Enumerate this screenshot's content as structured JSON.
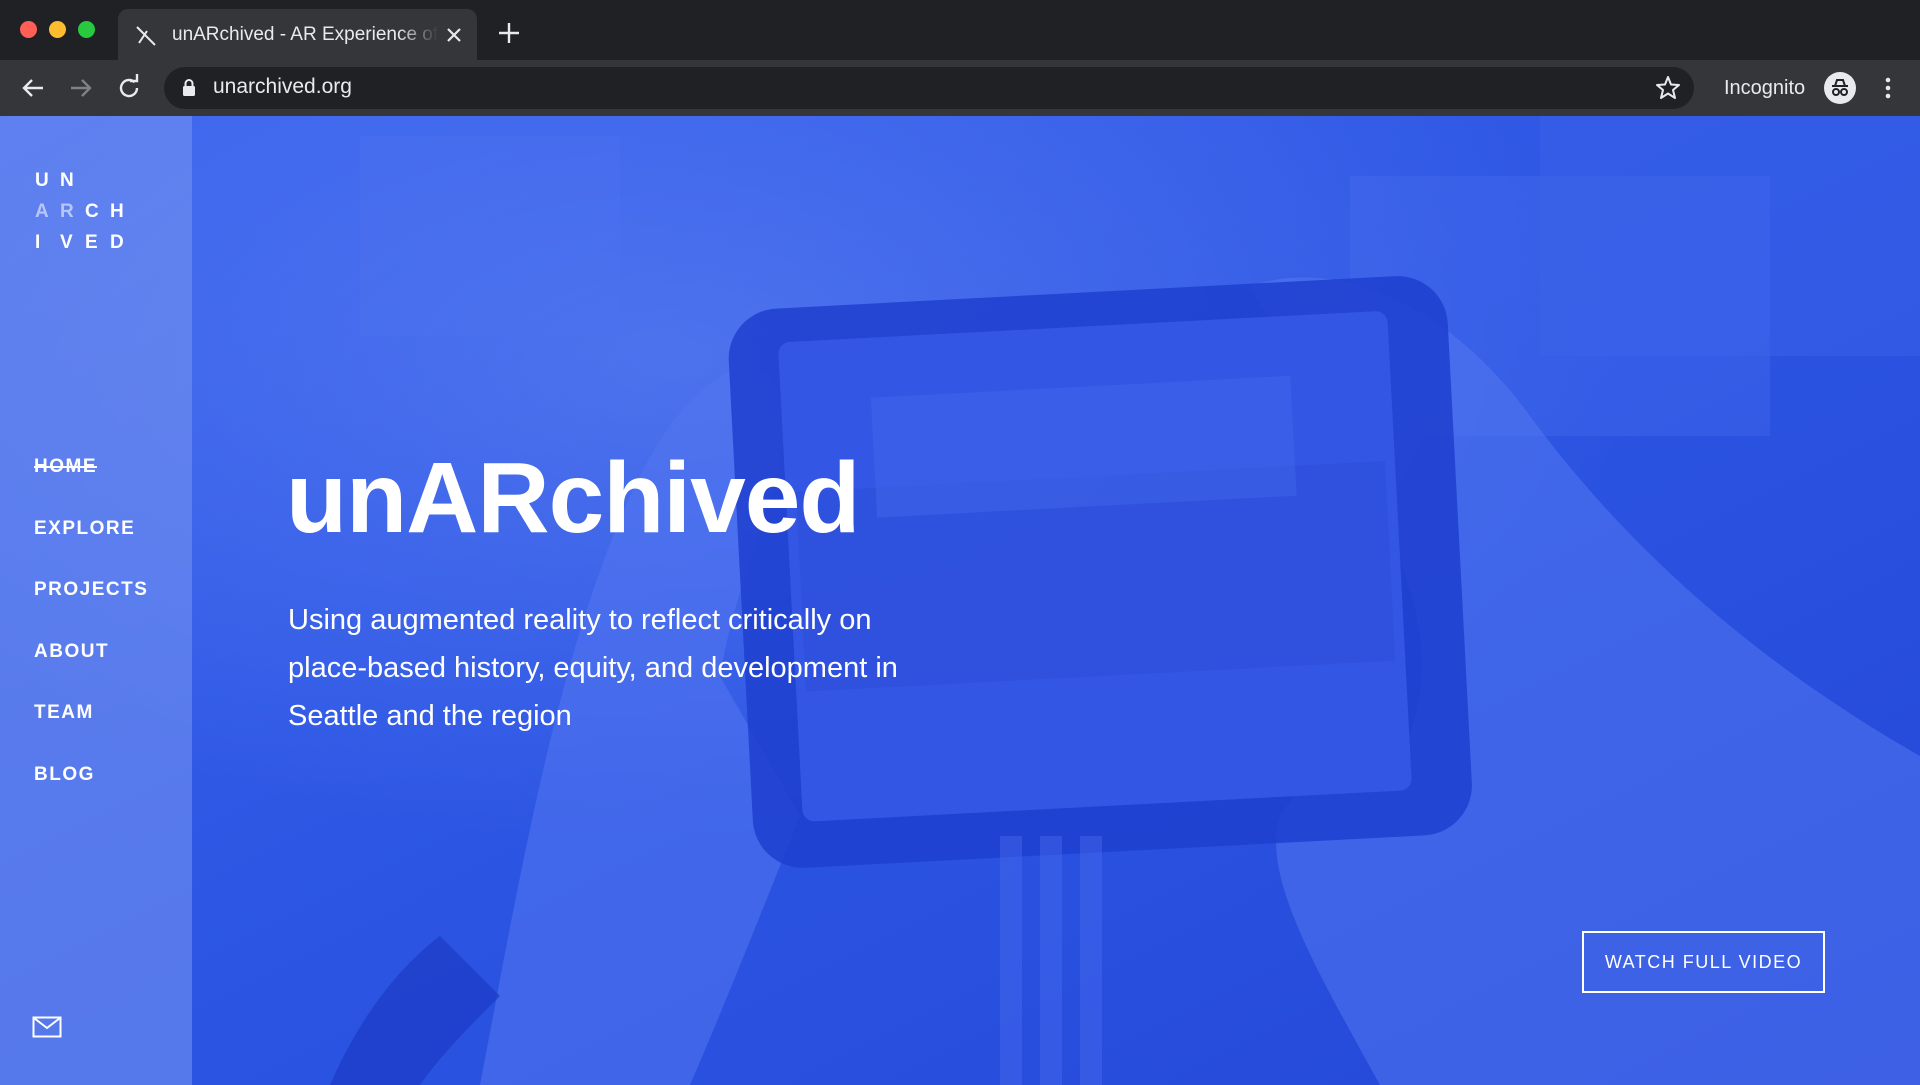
{
  "browser": {
    "tab_title": "unARchived - AR Experience of Seattle",
    "url": "unarchived.org",
    "incognito_label": "Incognito"
  },
  "logo": {
    "rows": [
      [
        "U",
        "N"
      ],
      [
        "A",
        "R",
        "C",
        "H"
      ],
      [
        "I",
        "V",
        "E",
        "D"
      ]
    ]
  },
  "nav": {
    "items": [
      "HOME",
      "EXPLORE",
      "PROJECTS",
      "ABOUT",
      "TEAM",
      "BLOG"
    ],
    "active": "HOME"
  },
  "hero": {
    "title": "unARchived",
    "subtitle_lines": [
      "Using augmented reality to reflect critically on",
      "place-based history, equity, and development in",
      "Seattle and the region"
    ],
    "watch_button": "WATCH FULL VIDEO"
  },
  "icons": {
    "favicon": "unarchived-logo-icon",
    "mail": "mail-icon",
    "lock": "lock-icon",
    "star": "bookmark-star-icon",
    "incognito": "incognito-icon"
  },
  "colors": {
    "brand_blue": "#2c58e8",
    "sidebar_tint": "#7896f0",
    "chrome_dark": "#202124",
    "chrome_toolbar": "#35363a"
  }
}
